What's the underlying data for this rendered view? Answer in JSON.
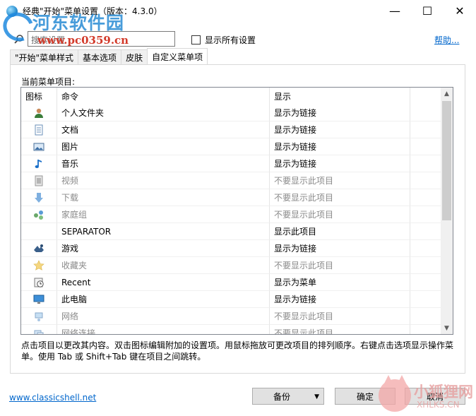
{
  "window": {
    "title": "经典\"开始\"菜单设置（版本：4.3.0）",
    "minimize": "—",
    "maximize": "☐",
    "close": "✕"
  },
  "watermark_top": {
    "text": "河东软件园",
    "url": "www.pc0359.cn"
  },
  "toolbar": {
    "search_placeholder": "搜索设置",
    "show_all_label": "显示所有设置",
    "show_all_checked": false,
    "help_link": "帮助..."
  },
  "tabs": [
    {
      "label": "\"开始\"菜单样式",
      "active": false
    },
    {
      "label": "基本选项",
      "active": false
    },
    {
      "label": "皮肤",
      "active": false
    },
    {
      "label": "自定义菜单项",
      "active": true
    }
  ],
  "panel": {
    "list_label": "当前菜单项目:",
    "columns": [
      "图标",
      "命令",
      "显示"
    ],
    "rows": [
      {
        "icon": "user-folder-icon",
        "command": "个人文件夹",
        "display": "显示为链接",
        "dim": false
      },
      {
        "icon": "document-icon",
        "command": "文档",
        "display": "显示为链接",
        "dim": false
      },
      {
        "icon": "picture-icon",
        "command": "图片",
        "display": "显示为链接",
        "dim": false
      },
      {
        "icon": "music-note-icon",
        "command": "音乐",
        "display": "显示为链接",
        "dim": false
      },
      {
        "icon": "video-icon",
        "command": "视频",
        "display": "不要显示此项目",
        "dim": true
      },
      {
        "icon": "download-arrow-icon",
        "command": "下载",
        "display": "不要显示此项目",
        "dim": true
      },
      {
        "icon": "homegroup-icon",
        "command": "家庭组",
        "display": "不要显示此项目",
        "dim": true
      },
      {
        "icon": "",
        "command": "SEPARATOR",
        "display": "显示此项目",
        "dim": false
      },
      {
        "icon": "games-icon",
        "command": "游戏",
        "display": "显示为链接",
        "dim": false
      },
      {
        "icon": "favorites-star-icon",
        "command": "收藏夹",
        "display": "不要显示此项目",
        "dim": true
      },
      {
        "icon": "recent-clock-icon",
        "command": "Recent",
        "display": "显示为菜单",
        "dim": false
      },
      {
        "icon": "computer-monitor-icon",
        "command": "此电脑",
        "display": "显示为链接",
        "dim": false
      },
      {
        "icon": "network-icon",
        "command": "网络",
        "display": "不要显示此项目",
        "dim": true
      },
      {
        "icon": "network-connections-icon",
        "command": "网络连接",
        "display": "不要显示此项目",
        "dim": true
      }
    ],
    "description": "点击项目以更改其内容。双击图标编辑附加的设置项。用鼠标拖放可更改项目的排列顺序。右键点击选项显示操作菜单。使用 Tab 或 Shift+Tab 键在项目之间跳转。"
  },
  "footer": {
    "site_link": "www.classicshell.net",
    "backup_label": "备份",
    "ok_label": "确定",
    "cancel_label": "取消"
  },
  "watermark_bottom": {
    "text": "小狐狸网",
    "url": "XHLKS.CN"
  },
  "colors": {
    "link": "#0066cc",
    "dim_text": "#8a8a8a",
    "tab_border": "#d9d9d9"
  }
}
